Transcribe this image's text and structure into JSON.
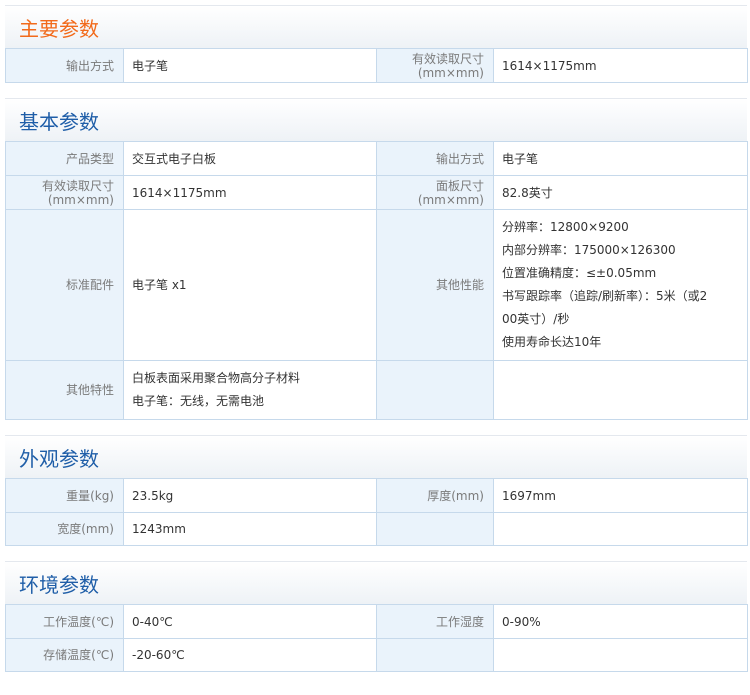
{
  "sections": {
    "main": {
      "title": "主要参数",
      "rows": [
        [
          "输出方式",
          "电子笔",
          "有效读取尺寸(mm×mm)",
          "1614×1175mm"
        ]
      ]
    },
    "basic": {
      "title": "基本参数",
      "r1": [
        "产品类型",
        "交互式电子白板",
        "输出方式",
        "电子笔"
      ],
      "r2": [
        "有效读取尺寸(mm×mm)",
        "1614×1175mm",
        "面板尺寸(mm×mm)",
        "82.8英寸"
      ],
      "r3": {
        "label1": "标准配件",
        "value1": "电子笔 x1",
        "label2": "其他性能",
        "value2_lines": [
          "分辨率：12800×9200",
          "内部分辨率：175000×126300",
          "位置准确精度：≤±0.05mm",
          "书写跟踪率（追踪/刷新率）：5米（或2",
          "00英寸）/秒",
          "使用寿命长达10年"
        ]
      },
      "r4": {
        "label1": "其他特性",
        "value1_lines": [
          "白板表面采用聚合物高分子材料",
          "电子笔：无线，无需电池"
        ]
      }
    },
    "appearance": {
      "title": "外观参数",
      "r1": [
        "重量(kg)",
        "23.5kg",
        "厚度(mm)",
        "1697mm"
      ],
      "r2": [
        "宽度(mm)",
        "1243mm"
      ]
    },
    "environment": {
      "title": "环境参数",
      "r1": [
        "工作温度(℃)",
        "0-40℃",
        "工作湿度",
        "0-90%"
      ],
      "r2": [
        "存储温度(℃)",
        "-20-60℃"
      ]
    }
  },
  "colors": {
    "orange_title": "#f26a1b",
    "blue_title": "#1f5ea8",
    "label_bg": "#eaf3fb",
    "border": "#c6d9eb"
  }
}
